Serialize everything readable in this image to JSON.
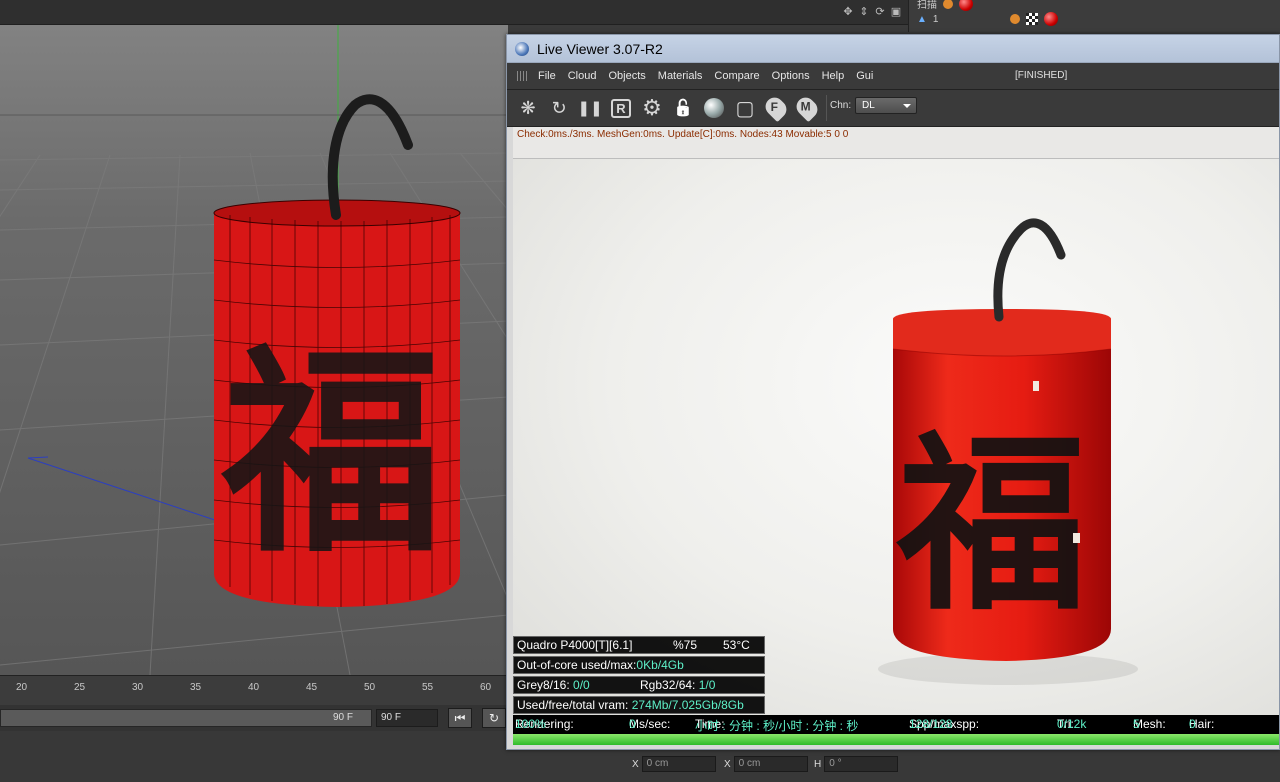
{
  "c4d": {
    "viewport_tools": [
      "move-view-icon",
      "pan-icon",
      "rotate-view-icon",
      "maximize-view-icon"
    ],
    "object_manager": {
      "rows": [
        {
          "label": "扫描"
        },
        {
          "label": "1"
        }
      ]
    },
    "timeline_ticks": [
      "20",
      "25",
      "30",
      "35",
      "40",
      "45",
      "50",
      "55",
      "60"
    ],
    "frame_end_bar": "90 F",
    "frame_end_field": "90 F",
    "coords": [
      {
        "axis": "X",
        "value": "0 cm"
      },
      {
        "axis": "X",
        "value": "0 cm"
      },
      {
        "axis": "H",
        "value": "0 °"
      }
    ]
  },
  "live_viewer": {
    "title": "Live Viewer 3.07-R2",
    "menu": [
      "File",
      "Cloud",
      "Objects",
      "Materials",
      "Compare",
      "Options",
      "Help",
      "Gui"
    ],
    "status": "[FINISHED]",
    "toolbar": [
      {
        "name": "send-scene-icon",
        "glyph": "❋"
      },
      {
        "name": "restart-render-icon",
        "glyph": "↻"
      },
      {
        "name": "pause-render-icon",
        "glyph": "❚❚"
      },
      {
        "name": "region-render-icon",
        "glyph": "R"
      },
      {
        "name": "settings-gear-icon",
        "glyph": "⚙"
      },
      {
        "name": "lock-icon",
        "glyph": "🔓"
      },
      {
        "name": "material-sphere-icon",
        "glyph": ""
      },
      {
        "name": "region-select-icon",
        "glyph": "▢"
      },
      {
        "name": "focus-picker-icon",
        "glyph": "F"
      },
      {
        "name": "material-picker-icon",
        "glyph": "M"
      }
    ],
    "channel_label": "Chn:",
    "channel_value": "DL",
    "info_line": "Check:0ms./3ms. MeshGen:0ms. Update[C]:0ms. Nodes:43 Movable:5  0 0",
    "render_calligraphy": "福",
    "gpu_overlay": {
      "gpu": "Quadro P4000[T][6.1]",
      "usage": "%75",
      "temp": "53°C",
      "ooc_label": "Out-of-core used/max:",
      "ooc_value": "0Kb/4Gb",
      "grey_label": "Grey8/16: ",
      "grey_value": "0/0",
      "rgb_label": "Rgb32/64: ",
      "rgb_value": "1/0",
      "vram_label": "Used/free/total vram: ",
      "vram_value": "274Mb/7.025Gb/8Gb"
    },
    "statusbar": {
      "rendering_label": "Rendering: ",
      "rendering_value": "100%",
      "ms_label": "Ms/sec: ",
      "ms_value": "0",
      "time_label": "Time: ",
      "time_value": "小时 : 分钟 : 秒/小时 : 分钟 : 秒",
      "spp_label": "Spp/maxspp: ",
      "spp_value": "128/128",
      "tri_label": "Tri: ",
      "tri_value": "0/12k",
      "mesh_label": "Mesh: ",
      "mesh_value": "5",
      "hair_label": "Hair: ",
      "hair_value": "0"
    },
    "progress_fraction": 1.0
  }
}
